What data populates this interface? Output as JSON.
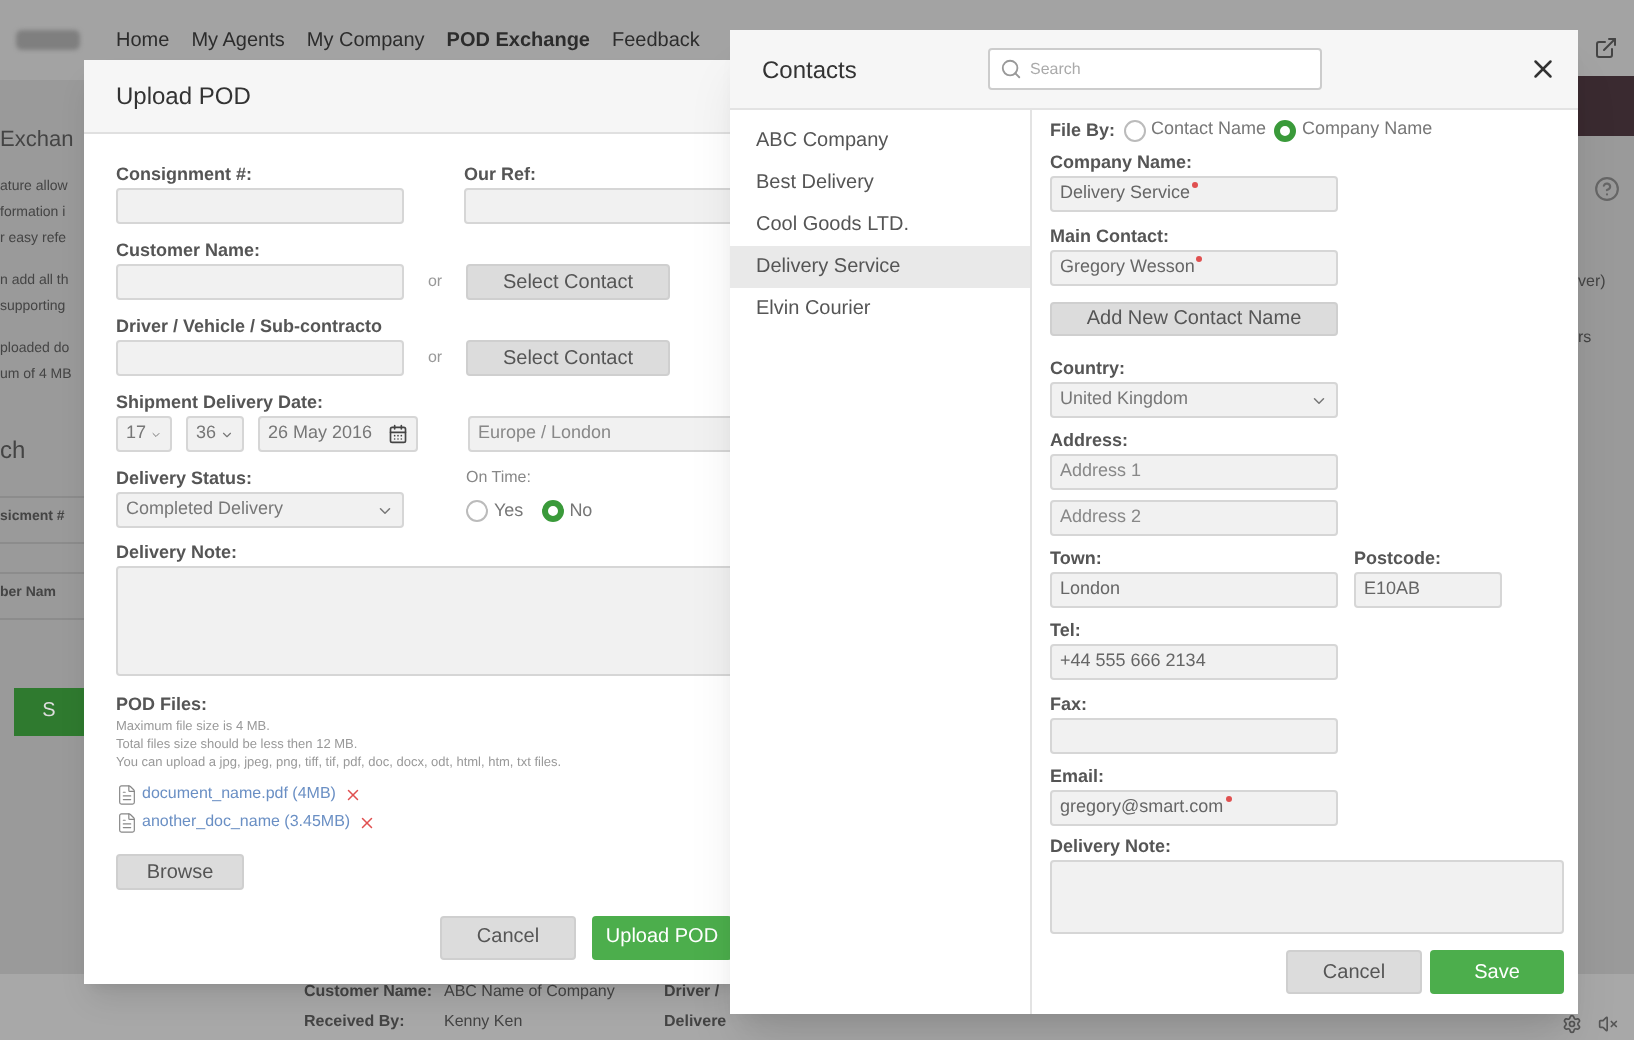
{
  "page": {
    "nav": [
      {
        "label": "Home",
        "selected": false
      },
      {
        "label": "My Agents",
        "selected": false
      },
      {
        "label": "My Company",
        "selected": false
      },
      {
        "label": "POD Exchange",
        "selected": true
      },
      {
        "label": "Feedback",
        "selected": false
      }
    ],
    "side_heading": "Exchan",
    "side_paragraphs": [
      [
        "ature allow",
        "formation i",
        "r easy refe"
      ],
      [
        "n add all th",
        "supporting"
      ],
      [
        "ploaded do",
        "um of 4 MB"
      ]
    ],
    "search_heading": "ch",
    "filter_labels": [
      "sicment #",
      "ber Nam"
    ],
    "search_button": "S",
    "right_notes": [
      "ver)",
      "rs"
    ],
    "details": [
      {
        "label": "Customer Name:",
        "value": "ABC Name of Company",
        "label_2": "Driver /"
      },
      {
        "label": "Received By:",
        "value": "Kenny Ken",
        "label_2": "Delivere"
      }
    ]
  },
  "upload_dialog": {
    "title": "Upload POD",
    "consignment": {
      "label": "Consignment #:"
    },
    "our_ref": {
      "label": "Our Ref:"
    },
    "customer": {
      "label": "Customer Name:",
      "or": "or",
      "button": "Select Contact"
    },
    "driver": {
      "label": "Driver / Vehicle / Sub-contracto",
      "or": "or",
      "button": "Select Contact"
    },
    "date": {
      "label": "Shipment Delivery Date:",
      "hour": "17",
      "minute": "36",
      "date": "26 May 2016",
      "timezone": "Europe / London"
    },
    "status": {
      "label": "Delivery Status:",
      "value": "Completed Delivery"
    },
    "on_time": {
      "label": "On Time:",
      "options": [
        {
          "label": "Yes",
          "selected": false
        },
        {
          "label": "No",
          "selected": true
        }
      ]
    },
    "note": {
      "label": "Delivery Note:"
    },
    "files": {
      "label": "POD Files:",
      "hints": [
        "Maximum file size is 4 MB.",
        "Total files size should be less then 12 MB.",
        "You can upload a jpg, jpeg, png, tiff, tif, pdf, doc, docx, odt, html, htm, txt files."
      ],
      "items": [
        {
          "name": "document_name.pdf (4MB)"
        },
        {
          "name": "another_doc_name (3.45MB)"
        }
      ]
    },
    "browse": "Browse",
    "cancel": "Cancel",
    "submit": "Upload POD"
  },
  "contacts_dialog": {
    "title": "Contacts",
    "search": {
      "placeholder": "Search"
    },
    "list": [
      {
        "label": "ABC Company",
        "selected": false
      },
      {
        "label": "Best Delivery",
        "selected": false
      },
      {
        "label": "Cool Goods LTD.",
        "selected": false
      },
      {
        "label": "Delivery Service",
        "selected": true
      },
      {
        "label": "Elvin Courier",
        "selected": false
      }
    ],
    "file_by": {
      "label": "File By:",
      "options": [
        {
          "label": "Contact Name",
          "selected": false
        },
        {
          "label": "Company Name",
          "selected": true
        }
      ]
    },
    "company": {
      "label": "Company Name:",
      "value": "Delivery Service",
      "required": true
    },
    "contact": {
      "label": "Main Contact:",
      "value": "Gregory Wesson",
      "required": true
    },
    "add_contact": "Add New Contact Name",
    "country": {
      "label": "Country:",
      "value": "United Kingdom"
    },
    "address": {
      "label": "Address:",
      "placeholders": [
        "Address 1",
        "Address 2"
      ]
    },
    "town": {
      "label": "Town:",
      "value": "London"
    },
    "postcode": {
      "label": "Postcode:",
      "value": "E10AB"
    },
    "tel": {
      "label": "Tel:",
      "value": "+44 555 666 2134"
    },
    "fax": {
      "label": "Fax:"
    },
    "email": {
      "label": "Email:",
      "value": "gregory@smart.com",
      "required": true
    },
    "note": {
      "label": "Delivery Note:"
    },
    "cancel": "Cancel",
    "save": "Save"
  }
}
